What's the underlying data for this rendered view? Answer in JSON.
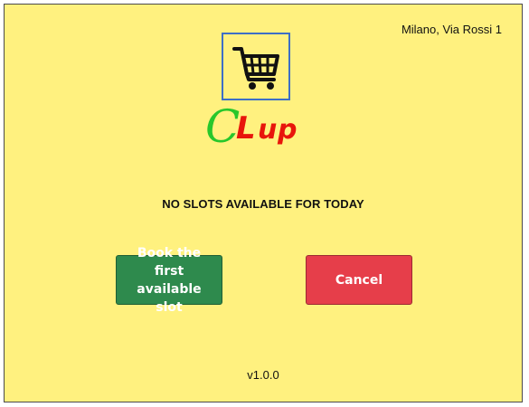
{
  "header": {
    "location": "Milano, Via Rossi 1"
  },
  "logo": {
    "icon": "shopping-cart-icon",
    "brand_parts": [
      "C",
      "L",
      "u",
      "p"
    ],
    "colors": {
      "c": "#27c72b",
      "rest": "#e8150b"
    }
  },
  "main": {
    "message": "NO SLOTS AVAILABLE FOR TODAY"
  },
  "actions": {
    "book_label": "Book the first\navailable slot",
    "cancel_label": "Cancel"
  },
  "footer": {
    "version": "v1.0.0"
  },
  "theme": {
    "background": "#fff17f",
    "book_color": "#2e8a4d",
    "cancel_color": "#e63e4a"
  }
}
